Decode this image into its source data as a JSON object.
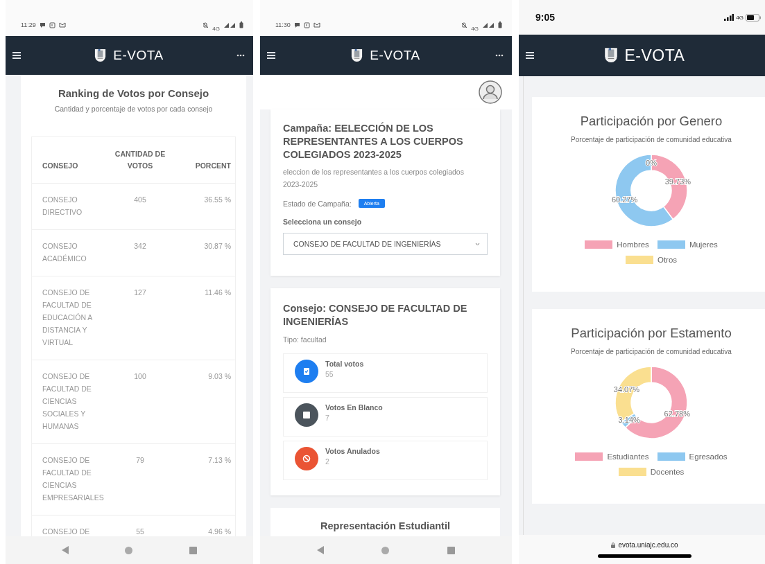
{
  "panels": [
    {
      "kind": "ranking",
      "status_bar": {
        "kind": "android",
        "time": "11:29",
        "network": "4G"
      },
      "header": {
        "title": "E-VOTA",
        "more_button": true
      },
      "bottom": {
        "kind": "nav"
      },
      "card": {
        "title": "Ranking de Votos por Consejo",
        "subtitle": "Cantidad y porcentaje de votos por cada consejo",
        "table": {
          "columns": [
            "CONSEJO",
            "CANTIDAD DE VOTOS",
            "PORCENT"
          ],
          "rows": [
            [
              "CONSEJO DIRECTIVO",
              "405",
              "36.55 %"
            ],
            [
              "CONSEJO ACADÉMICO",
              "342",
              "30.87 %"
            ],
            [
              "CONSEJO DE FACULTAD DE EDUCACIÓN A DISTANCIA Y VIRTUAL",
              "127",
              "11.46 %"
            ],
            [
              "CONSEJO DE FACULTAD DE CIENCIAS SOCIALES Y HUMANAS",
              "100",
              "9.03 %"
            ],
            [
              "CONSEJO DE FACULTAD DE CIENCIAS EMPRESARIALES",
              "79",
              "7.13 %"
            ],
            [
              "CONSEJO DE",
              "55",
              "4.96 %"
            ]
          ]
        }
      }
    },
    {
      "kind": "campaign",
      "status_bar": {
        "kind": "android",
        "time": "11:30",
        "network": "4G"
      },
      "header": {
        "title": "E-VOTA",
        "more_button": true
      },
      "bottom": {
        "kind": "nav"
      },
      "campaign": {
        "title": "Campaña: EELECCIÓN DE LOS REPRESENTANTES A LOS CUERPOS COLEGIADOS 2023-2025",
        "description": "eleccion de los representantes a los cuerpos colegiados 2023-2025",
        "status_label": "Estado de Campaña:",
        "status": "Abierta",
        "select_label": "Selecciona un consejo",
        "select_value": "CONSEJO DE FACULTAD DE INGENIERÍAS"
      },
      "council": {
        "title": "Consejo: CONSEJO DE FACULTAD DE INGENIERÍAS",
        "type": "Tipo: facultad",
        "stats": [
          {
            "kind": "total",
            "label": "Total votos",
            "value": "55",
            "color": "#1e7ef0"
          },
          {
            "kind": "blank",
            "label": "Votos En Blanco",
            "value": "7",
            "color": "#4b545c"
          },
          {
            "kind": "void",
            "label": "Votos Anulados",
            "value": "2",
            "color": "#ea5434"
          }
        ]
      },
      "section": {
        "title": "Representación Estudiantil"
      }
    },
    {
      "kind": "charts",
      "status_bar": {
        "kind": "ios",
        "time": "9:05",
        "network": "4G"
      },
      "header": {
        "title": "E-VOTA",
        "more_button": false
      },
      "bottom": {
        "kind": "url",
        "url": "evota.uniajc.edu.co"
      },
      "charts": [
        {
          "title": "Participación por Genero",
          "subtitle": "Porcentaje de participación de comunidad educativa",
          "chart_data": {
            "type": "donut",
            "categories": [
              "Hombres",
              "Mujeres",
              "Otros"
            ],
            "values": [
              39.73,
              60.27,
              0
            ],
            "colors": [
              "#f5a3b5",
              "#8ec8f0",
              "#fadf90"
            ],
            "value_labels": [
              "39.73%",
              "60.27%",
              "0%"
            ],
            "legend": "bottom"
          }
        },
        {
          "title": "Participación por Estamento",
          "subtitle": "Porcentaje de participación de comunidad educativa",
          "chart_data": {
            "type": "donut",
            "categories": [
              "Estudiantes",
              "Egresados",
              "Docentes"
            ],
            "values": [
              62.78,
              3.14,
              34.07
            ],
            "colors": [
              "#f5a3b5",
              "#8ec8f0",
              "#fadf90"
            ],
            "value_labels": [
              "62.78%",
              "3.14%",
              "34.07%"
            ],
            "legend": "bottom"
          }
        }
      ]
    }
  ]
}
